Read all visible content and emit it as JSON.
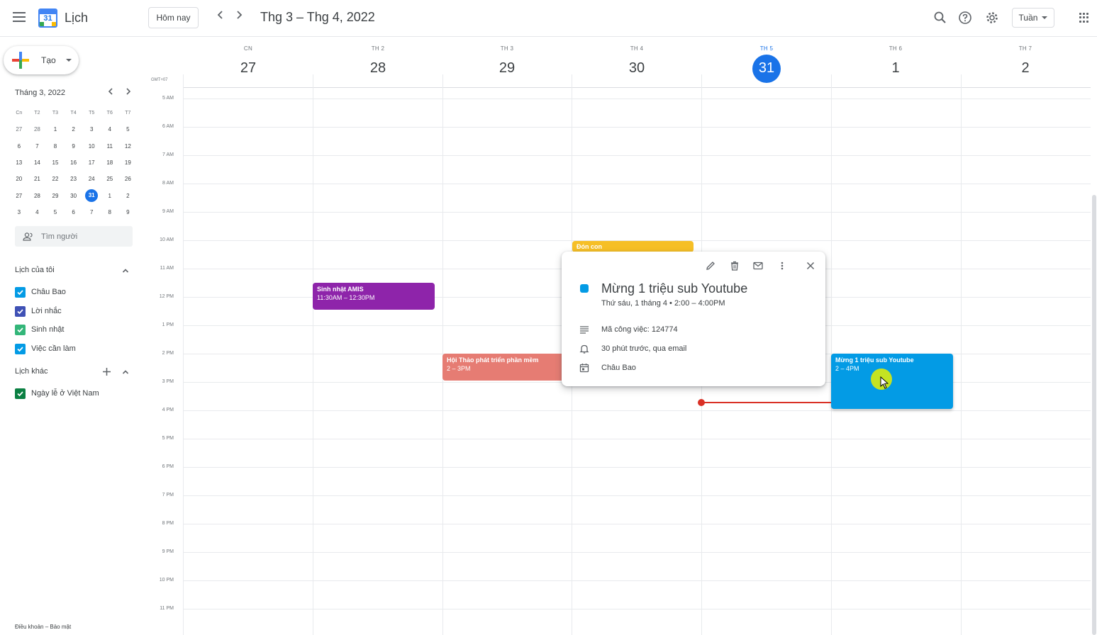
{
  "header": {
    "app_title": "Lịch",
    "logo_number": "31",
    "today_label": "Hôm nay",
    "range_title": "Thg 3 – Thg 4, 2022",
    "view_label": "Tuần"
  },
  "sidebar": {
    "create_label": "Tạo",
    "mini_calendar": {
      "title": "Tháng 3, 2022",
      "weekday_heads": [
        "Cn",
        "T2",
        "T3",
        "T4",
        "T5",
        "T6",
        "T7"
      ],
      "weeks": [
        [
          "27",
          "28",
          "1",
          "2",
          "3",
          "4",
          "5"
        ],
        [
          "6",
          "7",
          "8",
          "9",
          "10",
          "11",
          "12"
        ],
        [
          "13",
          "14",
          "15",
          "16",
          "17",
          "18",
          "19"
        ],
        [
          "20",
          "21",
          "22",
          "23",
          "24",
          "25",
          "26"
        ],
        [
          "27",
          "28",
          "29",
          "30",
          "31",
          "1",
          "2"
        ],
        [
          "3",
          "4",
          "5",
          "6",
          "7",
          "8",
          "9"
        ]
      ],
      "today": "31"
    },
    "search_people_placeholder": "Tìm người",
    "my_calendars_title": "Lịch của tôi",
    "my_calendars": [
      {
        "label": "Châu Bao",
        "color": "#039be5"
      },
      {
        "label": "Lời nhắc",
        "color": "#3f51b5"
      },
      {
        "label": "Sinh nhật",
        "color": "#33b679"
      },
      {
        "label": "Việc cần làm",
        "color": "#039be5"
      }
    ],
    "other_calendars_title": "Lịch khác",
    "other_calendars": [
      {
        "label": "Ngày lễ ở Việt Nam",
        "color": "#0b8043"
      }
    ],
    "footer": "Điều khoản – Bảo mật"
  },
  "week": {
    "timezone": "GMT+07",
    "days": [
      {
        "dow": "CN",
        "num": "27"
      },
      {
        "dow": "TH 2",
        "num": "28"
      },
      {
        "dow": "TH 3",
        "num": "29"
      },
      {
        "dow": "TH 4",
        "num": "30"
      },
      {
        "dow": "TH 5",
        "num": "31",
        "today": true
      },
      {
        "dow": "TH 6",
        "num": "1"
      },
      {
        "dow": "TH 7",
        "num": "2"
      }
    ],
    "hours": [
      "5 AM",
      "6 AM",
      "7 AM",
      "8 AM",
      "9 AM",
      "10 AM",
      "11 AM",
      "12 PM",
      "1 PM",
      "2 PM",
      "3 PM",
      "4 PM",
      "5 PM",
      "6 PM",
      "7 PM",
      "8 PM",
      "9 PM",
      "10 PM",
      "11 PM"
    ]
  },
  "events": {
    "don_con": {
      "title": "Đón con",
      "color": "#f6bf26"
    },
    "sinh_nhat": {
      "title": "Sinh nhật AMIS",
      "time": "11:30AM – 12:30PM",
      "color": "#8e24aa"
    },
    "hoi_thao": {
      "title": "Hội Thảo phát triển phần mềm",
      "time": "2 – 3PM",
      "color": "#e67c73"
    },
    "mung": {
      "title": "Mừng 1 triệu sub Youtube",
      "time": "2 – 4PM",
      "color": "#039be5"
    }
  },
  "popup": {
    "title": "Mừng 1 triệu sub Youtube",
    "subtitle": "Thứ sáu, 1 tháng 4  •  2:00 – 4:00PM",
    "description": "Mã công việc: 124774",
    "reminder": "30 phút trước, qua email",
    "calendar": "Châu Bao",
    "color": "#039be5"
  }
}
